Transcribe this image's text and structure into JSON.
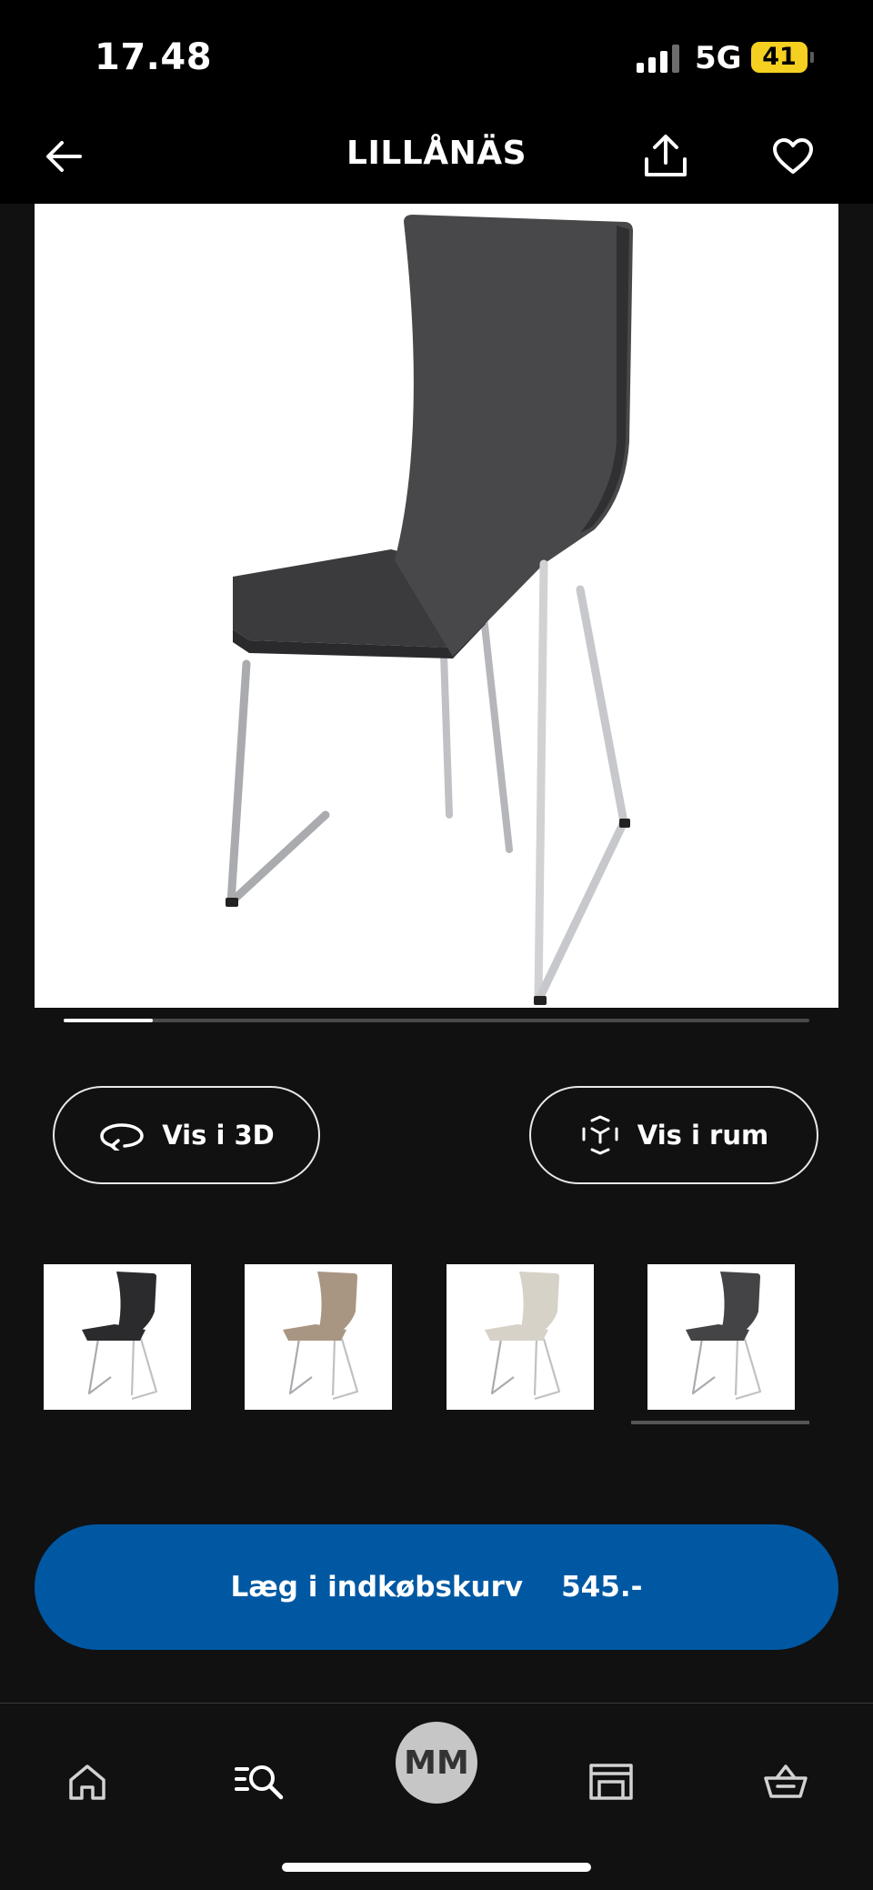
{
  "status_bar": {
    "time": "17.48",
    "network": "5G",
    "battery": "41"
  },
  "header": {
    "title": "LILLÅNÄS",
    "back_icon": "arrow-left-icon",
    "share_icon": "share-icon",
    "favorite_icon": "heart-icon"
  },
  "product": {
    "image_icon": "chair-photo",
    "carousel_position": 0.12,
    "actions": [
      {
        "label": "Vis i 3D",
        "icon": "rotate-3d-icon"
      },
      {
        "label": "Vis i rum",
        "icon": "ar-cube-icon"
      }
    ]
  },
  "variants": [
    {
      "seat_color": "#2b2b2d",
      "selected": false
    },
    {
      "seat_color": "#a99682",
      "selected": false
    },
    {
      "seat_color": "#d7d2c8",
      "selected": false
    },
    {
      "seat_color": "#444446",
      "selected": true
    }
  ],
  "cart": {
    "label": "Læg i indkøbskurv",
    "price": "545.-",
    "color": "#0058a3"
  },
  "bottom_nav": {
    "items": [
      {
        "icon": "home-icon"
      },
      {
        "icon": "search-list-icon"
      },
      {
        "icon": "profile-avatar",
        "label": "MM"
      },
      {
        "icon": "store-icon"
      },
      {
        "icon": "basket-icon"
      }
    ]
  }
}
